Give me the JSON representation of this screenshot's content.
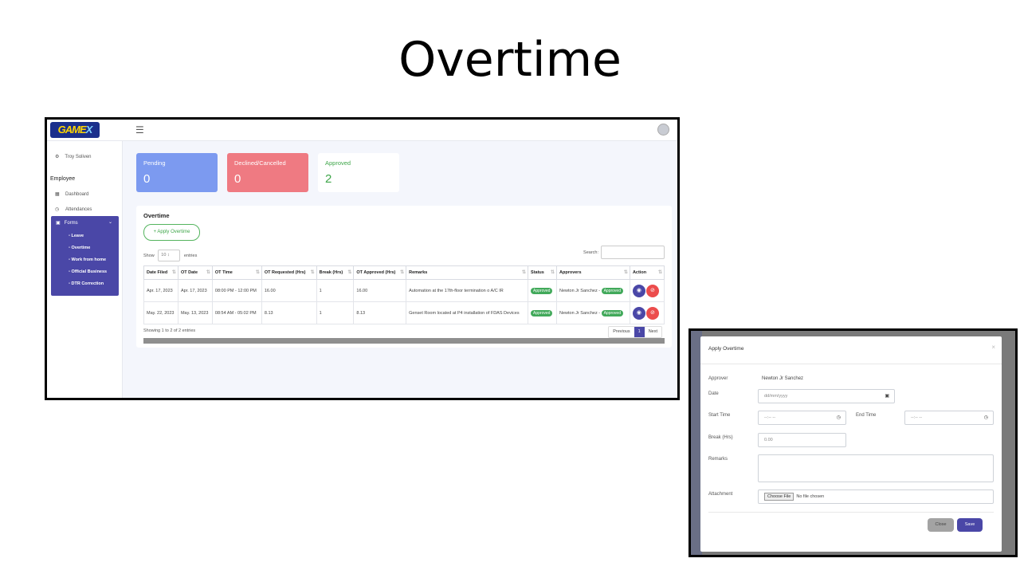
{
  "slide": {
    "title": "Overtime"
  },
  "app": {
    "logo": "GAME",
    "logo_accent": "X",
    "menu_icon": "hamburger-icon",
    "user_name": "Troy Soliven",
    "section_label": "Employee",
    "nav": {
      "dashboard": "Dashboard",
      "attendances": "Attendances",
      "forms": "Forms"
    },
    "forms_sub": [
      "Leave",
      "Overtime",
      "Work from home",
      "Official Business",
      "DTR Correction"
    ],
    "cards": {
      "pending": {
        "label": "Pending",
        "value": "0"
      },
      "declined": {
        "label": "Declined/Cancelled",
        "value": "0"
      },
      "approved": {
        "label": "Approved",
        "value": "2"
      }
    },
    "panel": {
      "title": "Overtime",
      "apply_label": "+ Apply Overtime",
      "show_label": "Show",
      "entries_value": "10",
      "entries_label": "entries",
      "search_label": "Search:",
      "columns": [
        "Date Filed",
        "OT Date",
        "OT Time",
        "OT Requested (Hrs)",
        "Break (Hrs)",
        "OT Approved (Hrs)",
        "Remarks",
        "Status",
        "Approvers",
        "Action"
      ],
      "rows": [
        {
          "filed": "Apr. 17, 2023",
          "ot_date": "Apr. 17, 2023",
          "time": "08:00 PM - 12:00 PM",
          "req": "16.00",
          "brk": "1",
          "appr": "16.00",
          "remarks": "Automation at the 17th-floor termination o A/C IR",
          "status": "Approved",
          "approver": "Newton Jr Sanchez -",
          "approver_status": "Approved"
        },
        {
          "filed": "May. 22, 2023",
          "ot_date": "May. 13, 2023",
          "time": "08:54 AM - 05:02 PM",
          "req": "8.13",
          "brk": "1",
          "appr": "8.13",
          "remarks": "Genset Room located at P4 installation of FDAS Devices",
          "status": "Approved",
          "approver": "Newton Jr Sanchez -",
          "approver_status": "Approved"
        }
      ],
      "showing": "Showing 1 to 2 of 2 entries",
      "pager": {
        "prev": "Previous",
        "page": "1",
        "next": "Next"
      }
    }
  },
  "modal": {
    "title": "Apply Overtime",
    "approver_label": "Approver",
    "approver_value": "Newton Jr Sanchez",
    "date_label": "Date",
    "date_placeholder": "dd/mm/yyyy",
    "start_label": "Start Time",
    "start_placeholder": "--:-- --",
    "end_label": "End Time",
    "end_placeholder": "--:-- --",
    "break_label": "Break (Hrs)",
    "break_placeholder": "0.00",
    "remarks_label": "Remarks",
    "attachment_label": "Attachment",
    "file_button": "Choose File",
    "file_status": "No file chosen",
    "close_label": "Close",
    "save_label": "Save"
  },
  "colors": {
    "primary": "#4a47a7",
    "pending": "#7c9af0",
    "declined": "#ef7a82",
    "approved": "#3fa64a",
    "danger": "#ec4c4c"
  }
}
